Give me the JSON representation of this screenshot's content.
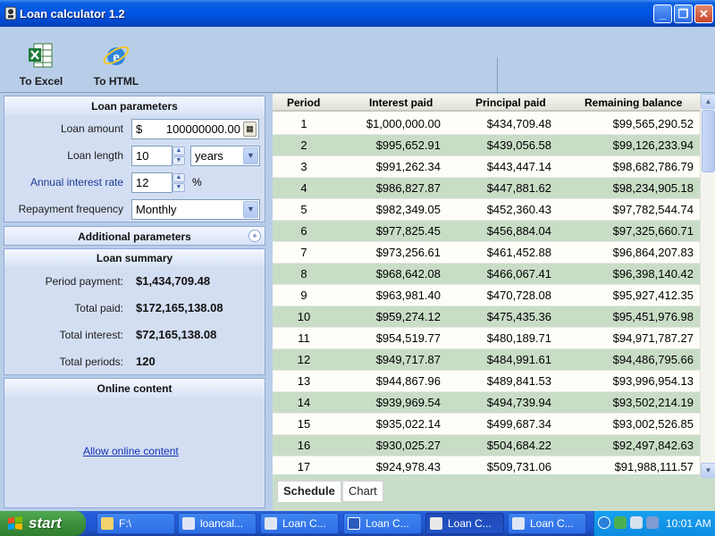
{
  "window": {
    "title": "Loan calculator 1.2",
    "minimize": "_",
    "maximize": "❐",
    "close": "✕"
  },
  "toolbar": {
    "excel_label": "To Excel",
    "html_label": "To HTML"
  },
  "loan_parameters": {
    "header": "Loan parameters",
    "amount_label": "Loan amount",
    "currency_symbol": "$",
    "amount_value": "100000000.00",
    "length_label": "Loan length",
    "length_value": "10",
    "length_unit": "years",
    "rate_label": "Annual interest rate",
    "rate_value": "12",
    "rate_unit": "%",
    "frequency_label": "Repayment frequency",
    "frequency_value": "Monthly"
  },
  "additional_parameters": {
    "header": "Additional parameters"
  },
  "loan_summary": {
    "header": "Loan summary",
    "period_payment_label": "Period payment:",
    "period_payment_value": "$1,434,709.48",
    "total_paid_label": "Total paid:",
    "total_paid_value": "$172,165,138.08",
    "total_interest_label": "Total interest:",
    "total_interest_value": "$72,165,138.08",
    "total_periods_label": "Total periods:",
    "total_periods_value": "120"
  },
  "online_content": {
    "header": "Online content",
    "link": "Allow online content"
  },
  "schedule": {
    "columns": [
      "Period",
      "Interest paid",
      "Principal paid",
      "Remaining balance"
    ],
    "rows": [
      [
        "1",
        "$1,000,000.00",
        "$434,709.48",
        "$99,565,290.52"
      ],
      [
        "2",
        "$995,652.91",
        "$439,056.58",
        "$99,126,233.94"
      ],
      [
        "3",
        "$991,262.34",
        "$443,447.14",
        "$98,682,786.79"
      ],
      [
        "4",
        "$986,827.87",
        "$447,881.62",
        "$98,234,905.18"
      ],
      [
        "5",
        "$982,349.05",
        "$452,360.43",
        "$97,782,544.74"
      ],
      [
        "6",
        "$977,825.45",
        "$456,884.04",
        "$97,325,660.71"
      ],
      [
        "7",
        "$973,256.61",
        "$461,452.88",
        "$96,864,207.83"
      ],
      [
        "8",
        "$968,642.08",
        "$466,067.41",
        "$96,398,140.42"
      ],
      [
        "9",
        "$963,981.40",
        "$470,728.08",
        "$95,927,412.35"
      ],
      [
        "10",
        "$959,274.12",
        "$475,435.36",
        "$95,451,976.98"
      ],
      [
        "11",
        "$954,519.77",
        "$480,189.71",
        "$94,971,787.27"
      ],
      [
        "12",
        "$949,717.87",
        "$484,991.61",
        "$94,486,795.66"
      ],
      [
        "13",
        "$944,867.96",
        "$489,841.53",
        "$93,996,954.13"
      ],
      [
        "14",
        "$939,969.54",
        "$494,739.94",
        "$93,502,214.19"
      ],
      [
        "15",
        "$935,022.14",
        "$499,687.34",
        "$93,002,526.85"
      ],
      [
        "16",
        "$930,025.27",
        "$504,684.22",
        "$92,497,842.63"
      ],
      [
        "17",
        "$924,978.43",
        "$509,731.06",
        "$91,988,111.57"
      ]
    ]
  },
  "tabs": [
    "Schedule",
    "Chart"
  ],
  "taskbar": {
    "start": "start",
    "tasks": [
      "F:\\",
      "loancal...",
      "Loan C...",
      "Loan C...",
      "Loan C...",
      "Loan C..."
    ],
    "clock": "10:01 AM"
  },
  "colors": {
    "title_bar": "#0054e3",
    "panel": "#d4def3",
    "row_alt": "#c9ddc6",
    "link": "#1034b8"
  }
}
